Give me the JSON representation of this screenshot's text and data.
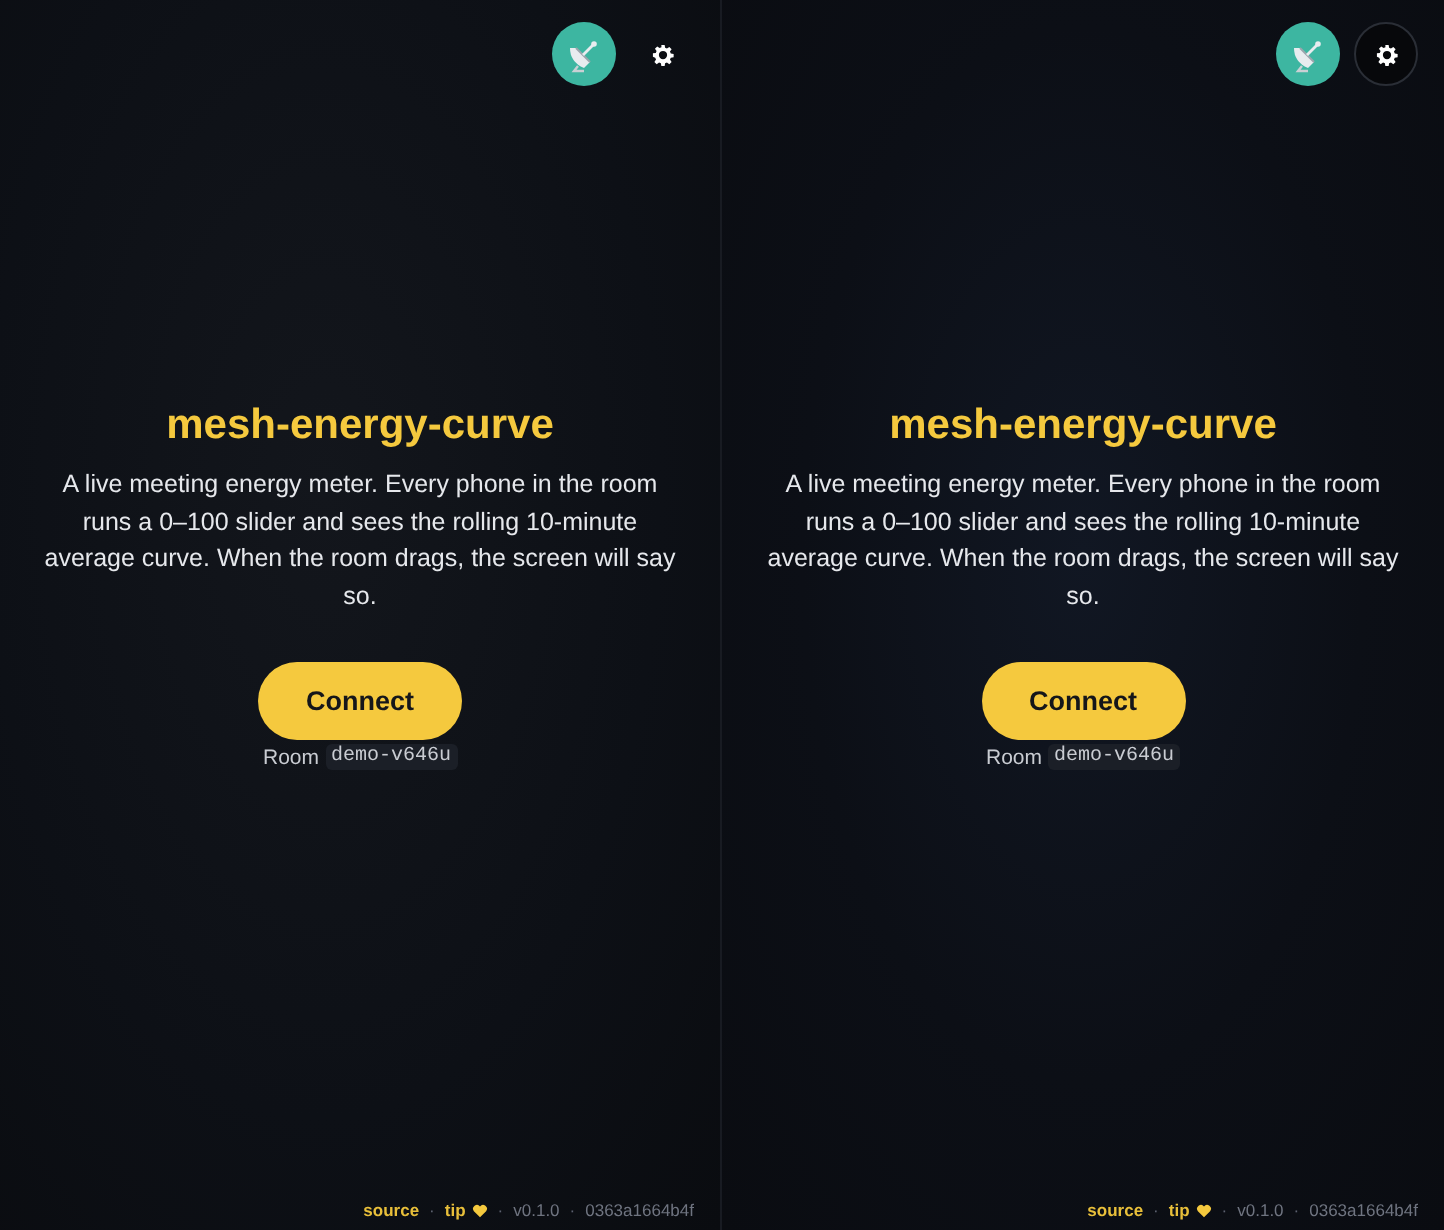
{
  "panels": [
    {
      "settings_button": {
        "ringed": false
      },
      "title": "mesh-energy-curve",
      "description": "A live meeting energy meter. Every phone in the room runs a 0–100 slider and sees the rolling 10-minute average curve. When the room drags, the screen will say so.",
      "connect_button": "Connect",
      "room": {
        "label": "Room",
        "code": "demo-v646u"
      },
      "footer": [
        {
          "kind": "link",
          "text": "source"
        },
        {
          "kind": "sep",
          "text": "·"
        },
        {
          "kind": "tip",
          "text": "tip"
        },
        {
          "kind": "sep",
          "text": "·"
        },
        {
          "kind": "version",
          "text": "v0.1.0"
        },
        {
          "kind": "sep",
          "text": "·"
        },
        {
          "kind": "commit",
          "text": "0363a1664b4f"
        }
      ]
    },
    {
      "settings_button": {
        "ringed": true
      },
      "title": "mesh-energy-curve",
      "description": "A live meeting energy meter. Every phone in the room runs a 0–100 slider and sees the rolling 10-minute average curve. When the room drags, the screen will say so.",
      "connect_button": "Connect",
      "room": {
        "label": "Room",
        "code": "demo-v646u"
      },
      "footer": [
        {
          "kind": "link",
          "text": "source"
        },
        {
          "kind": "sep",
          "text": "·"
        },
        {
          "kind": "tip",
          "text": "tip"
        },
        {
          "kind": "sep",
          "text": "·"
        },
        {
          "kind": "version",
          "text": "v0.1.0"
        },
        {
          "kind": "sep",
          "text": "·"
        },
        {
          "kind": "commit",
          "text": "0363a1664b4f"
        }
      ]
    }
  ]
}
